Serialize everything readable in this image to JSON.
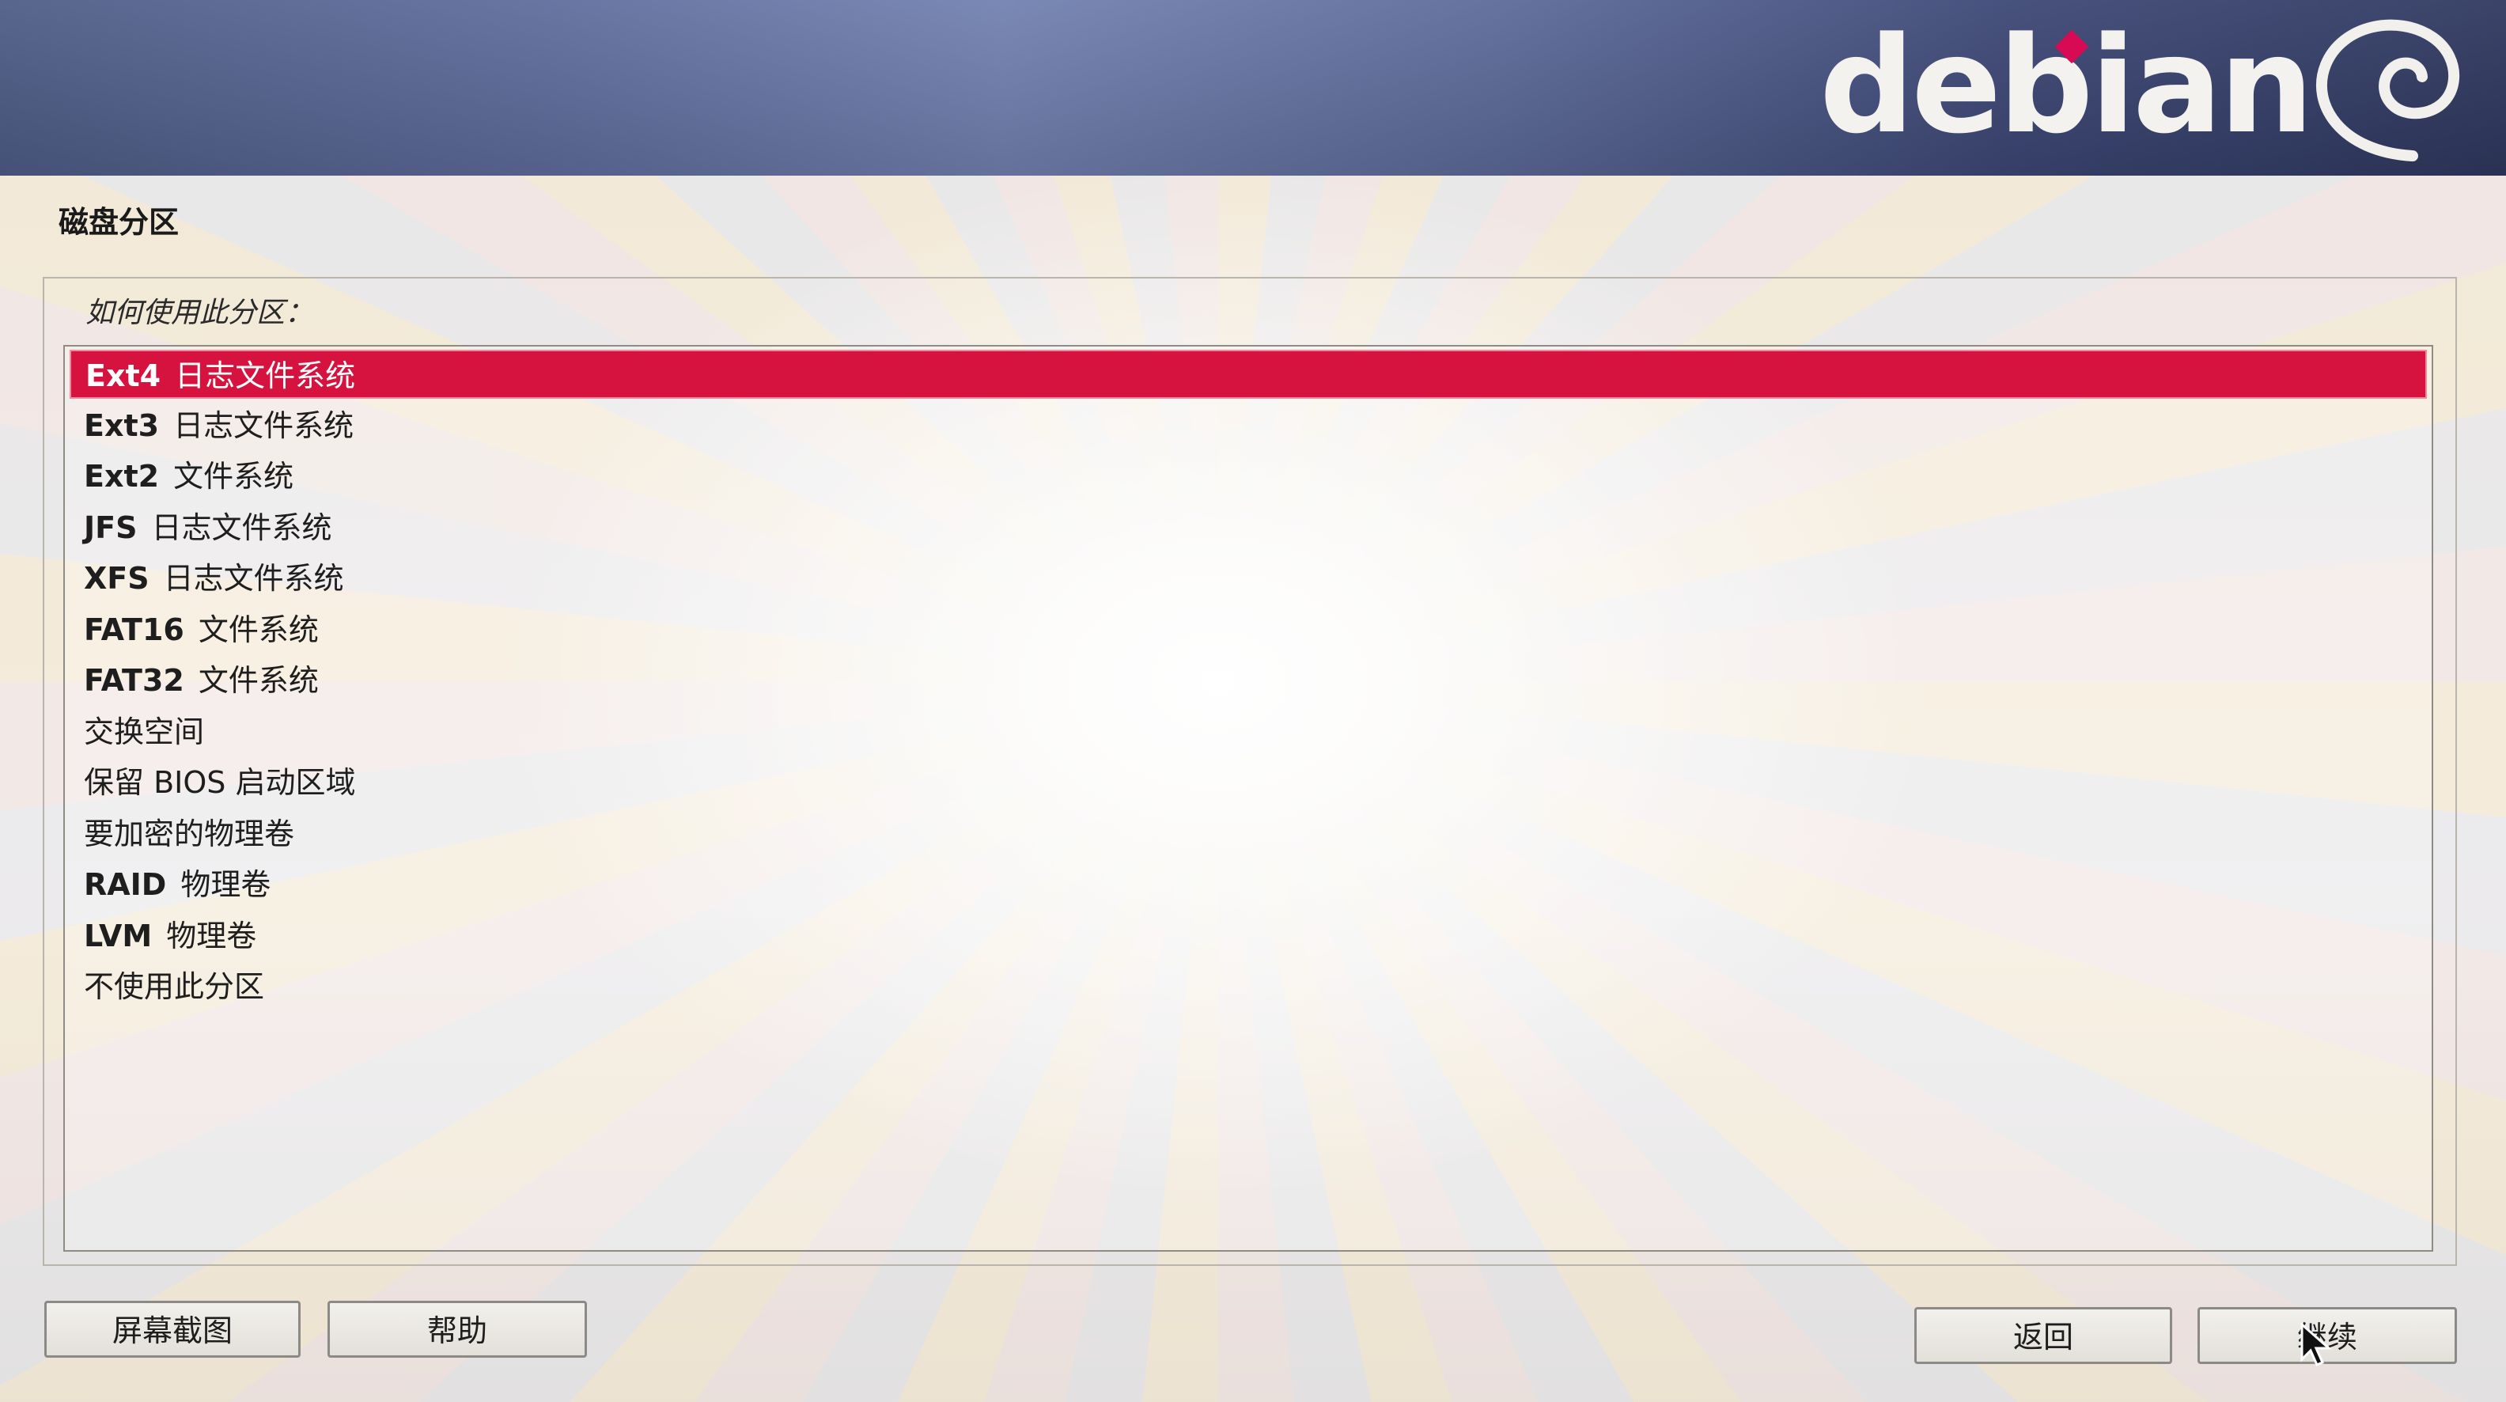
{
  "banner": {
    "logo_text": "debian",
    "logo_icon": "debian-swirl-icon",
    "accent_color": "#d70a53"
  },
  "page": {
    "title": "磁盘分区",
    "question": "如何使用此分区："
  },
  "partition_options": {
    "selected_index": 0,
    "items": [
      {
        "tag": "Ext4",
        "label": "日志文件系统"
      },
      {
        "tag": "Ext3",
        "label": "日志文件系统"
      },
      {
        "tag": "Ext2",
        "label": "文件系统"
      },
      {
        "tag": "JFS",
        "label": "日志文件系统"
      },
      {
        "tag": "XFS",
        "label": "日志文件系统"
      },
      {
        "tag": "FAT16",
        "label": "文件系统"
      },
      {
        "tag": "FAT32",
        "label": "文件系统"
      },
      {
        "tag": "",
        "label": "交换空间"
      },
      {
        "tag": "",
        "label": "保留 BIOS 启动区域"
      },
      {
        "tag": "",
        "label": "要加密的物理卷"
      },
      {
        "tag": "RAID",
        "label": "物理卷"
      },
      {
        "tag": "LVM",
        "label": "物理卷"
      },
      {
        "tag": "",
        "label": "不使用此分区"
      }
    ]
  },
  "buttons": {
    "screenshot": "屏幕截图",
    "help": "帮助",
    "back": "返回",
    "continue": "继续"
  },
  "colors": {
    "selection": "#d6123f",
    "banner": "#5f6d9c"
  }
}
